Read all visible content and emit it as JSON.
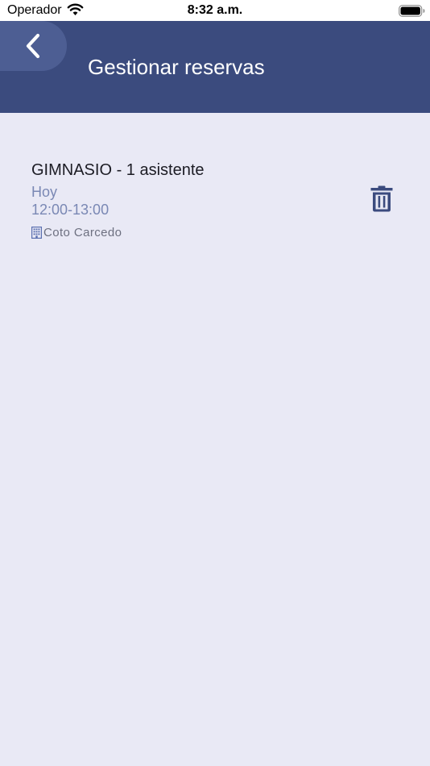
{
  "status_bar": {
    "carrier": "Operador",
    "time": "8:32 a.m."
  },
  "header": {
    "title": "Gestionar reservas",
    "back_icon": "chevron-left-icon",
    "background_color": "#3b4b7e"
  },
  "booking": {
    "title": "GIMNASIO - 1 asistente",
    "day": "Hoy",
    "time_range": "12:00-13:00",
    "location": "Coto Carcedo",
    "location_icon": "building-icon",
    "delete_icon": "trash-icon"
  },
  "colors": {
    "accent": "#3b4b7e",
    "background": "#e9e9f5",
    "secondary_text": "#7a88b4"
  }
}
